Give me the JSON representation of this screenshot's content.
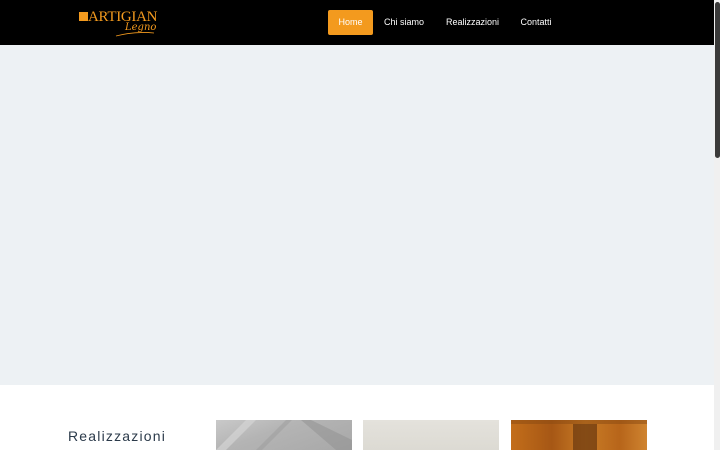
{
  "header": {
    "logo": {
      "main_text": "ARTIGIAN",
      "sub_text": "Legno"
    },
    "nav": [
      {
        "label": "Home",
        "active": true
      },
      {
        "label": "Chi siamo",
        "active": false
      },
      {
        "label": "Realizzazioni",
        "active": false
      },
      {
        "label": "Contatti",
        "active": false
      }
    ]
  },
  "section": {
    "title": "Realizzazioni"
  },
  "colors": {
    "accent": "#f39a1e",
    "header_bg": "#000000",
    "hero_bg": "#edf1f4",
    "title_text": "#2b3a4a"
  }
}
